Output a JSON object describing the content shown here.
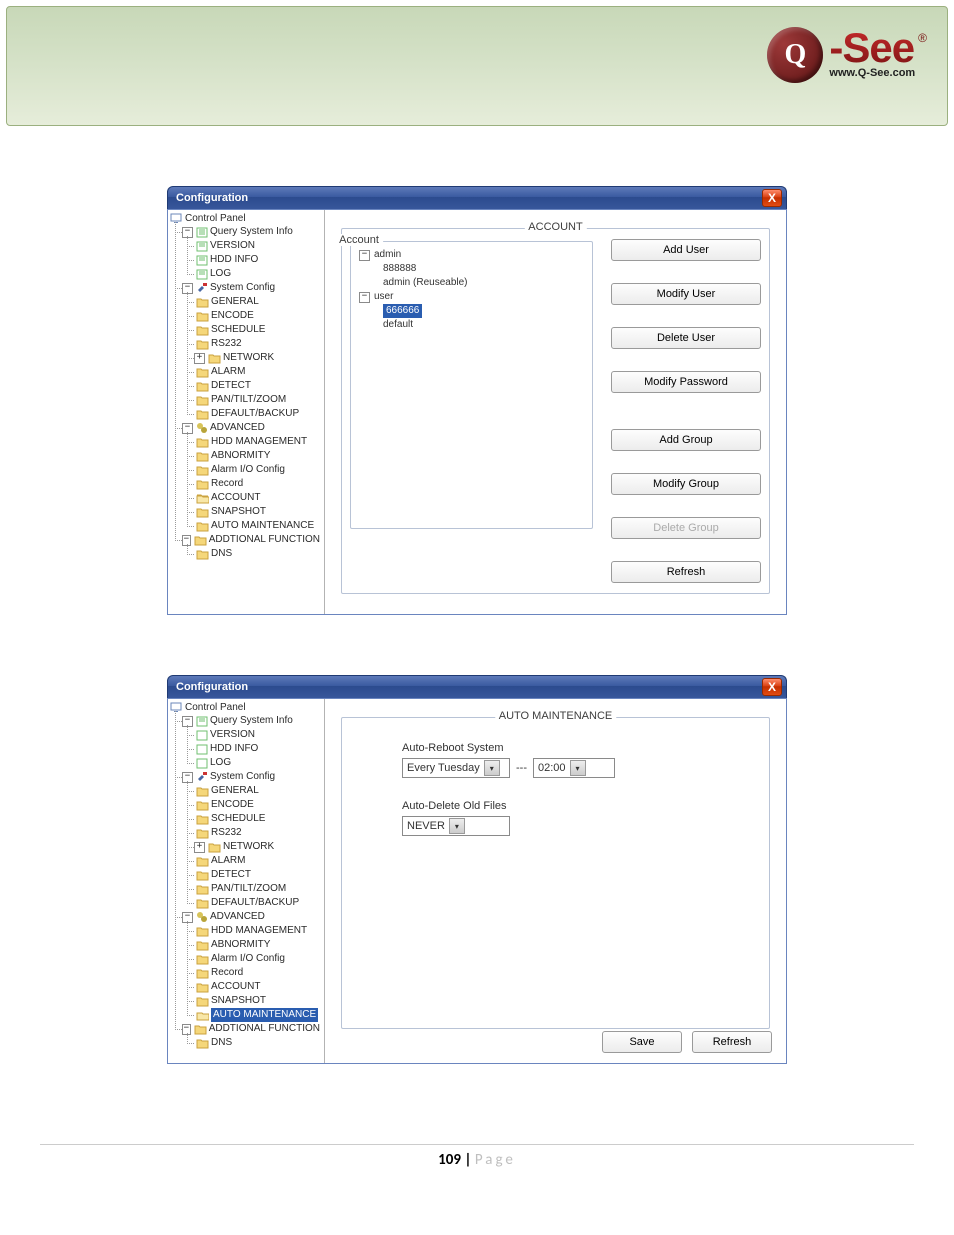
{
  "brand": {
    "logo_q": "Q",
    "hyphen": "-",
    "see": "See",
    "tm": "®",
    "url": "www.Q-See.com"
  },
  "footer": {
    "page_num": "109",
    "sep": " | ",
    "label": "Page"
  },
  "common": {
    "title": "Configuration",
    "close": "X",
    "tree_root": "Control Panel",
    "exp_minus": "−",
    "exp_plus": "+",
    "tree": {
      "qsi": {
        "label": "Query System Info",
        "children": {
          "version": "VERSION",
          "hdd": "HDD INFO",
          "log": "LOG"
        }
      },
      "sc": {
        "label": "System Config",
        "children": {
          "general": "GENERAL",
          "encode": "ENCODE",
          "schedule": "SCHEDULE",
          "rs232": "RS232",
          "network": "NETWORK",
          "alarm": "ALARM",
          "detect": "DETECT",
          "ptz": "PAN/TILT/ZOOM",
          "defbk": "DEFAULT/BACKUP"
        }
      },
      "adv": {
        "label": "ADVANCED",
        "children": {
          "hdd": "HDD MANAGEMENT",
          "abn": "ABNORMITY",
          "aio": "Alarm I/O Config",
          "rec": "Record",
          "acct": "ACCOUNT",
          "snap": "SNAPSHOT",
          "am": "AUTO MAINTENANCE"
        }
      },
      "add": {
        "label": "ADDTIONAL FUNCTION",
        "children": {
          "dns": "DNS"
        }
      }
    }
  },
  "shot1": {
    "heading": "ACCOUNT",
    "group_legend": "Account",
    "acct_tree": {
      "admin": "admin",
      "admin_c1": "888888",
      "admin_c2": "admin (Reuseable)",
      "user": "user",
      "user_c1": "666666",
      "user_c2": "default"
    },
    "buttons": {
      "add_user": "Add User",
      "mod_user": "Modify User",
      "del_user": "Delete User",
      "mod_pwd": "Modify Password",
      "add_grp": "Add Group",
      "mod_grp": "Modify Group",
      "del_grp": "Delete Group",
      "refresh": "Refresh"
    }
  },
  "shot2": {
    "heading": "AUTO MAINTENANCE",
    "label_reboot": "Auto-Reboot System",
    "dd_day": "Every Tuesday",
    "dash": "---",
    "dd_time": "02:00",
    "label_delete": "Auto-Delete Old Files",
    "dd_never": "NEVER",
    "buttons": {
      "save": "Save",
      "refresh": "Refresh"
    }
  }
}
